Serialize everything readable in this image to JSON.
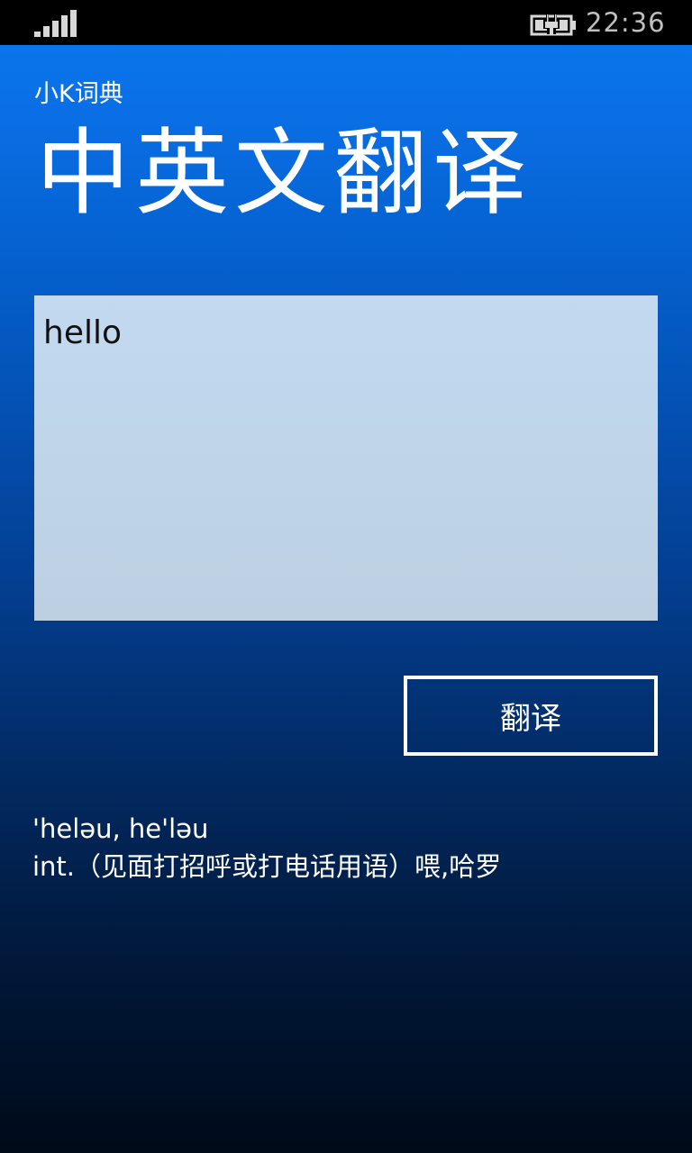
{
  "status_bar": {
    "signal_icon": "signal-bars-icon",
    "battery_icon": "battery-charging-icon",
    "time": "22:36"
  },
  "app": {
    "name": "小K词典",
    "page_title": "中英文翻译"
  },
  "input": {
    "value": "hello"
  },
  "actions": {
    "translate_label": "翻译"
  },
  "result": {
    "phonetic": "'heləu, he'ləu",
    "definition": "int.（见面打招呼或打电话用语）喂,哈罗"
  }
}
